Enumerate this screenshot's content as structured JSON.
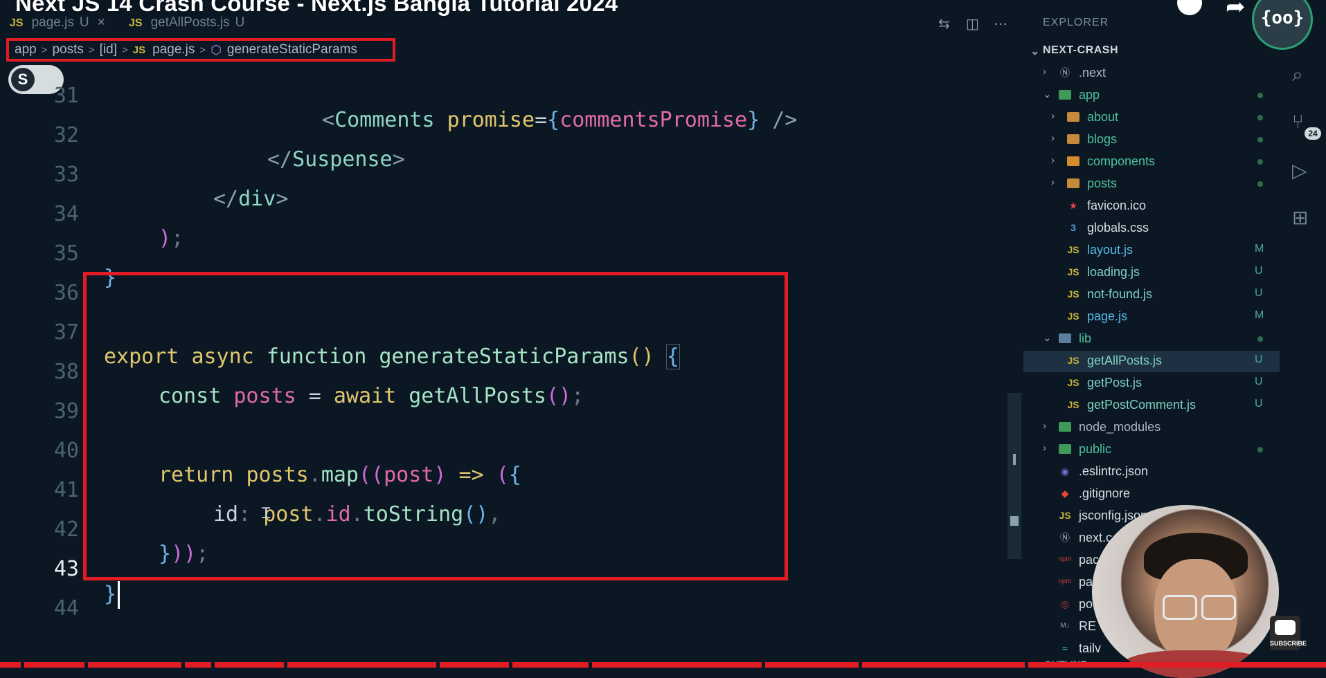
{
  "video_title": "Next JS 14 Crash Course - Next.js Bangla Tutorial 2024",
  "tabs": [
    {
      "icon": "JS",
      "name": "page.js",
      "status": "U",
      "close": "×"
    },
    {
      "icon": "JS",
      "name": "getAllPosts.js",
      "status": "U"
    }
  ],
  "editor_actions": [
    "⇆",
    "◫",
    "⋯"
  ],
  "breadcrumb": {
    "parts": [
      "app",
      "posts",
      "[id]"
    ],
    "file_icon": "JS",
    "file": "page.js",
    "symbol": "generateStaticParams",
    "separator": ">"
  },
  "toggle_label": "S",
  "code": {
    "line_numbers": [
      "31",
      "32",
      "33",
      "34",
      "35",
      "36",
      "37",
      "38",
      "39",
      "40",
      "41",
      "42",
      "43",
      "44"
    ],
    "current_line": "43"
  },
  "explorer": {
    "title": "EXPLORER",
    "root": "NEXT-CRASH",
    "items": [
      {
        "name": ".next",
        "status": ""
      },
      {
        "name": "app",
        "status": ""
      },
      {
        "name": "about",
        "status": ""
      },
      {
        "name": "blogs",
        "status": ""
      },
      {
        "name": "components",
        "status": ""
      },
      {
        "name": "posts",
        "status": ""
      },
      {
        "name": "favicon.ico",
        "status": ""
      },
      {
        "name": "globals.css",
        "status": ""
      },
      {
        "name": "layout.js",
        "status": "M"
      },
      {
        "name": "loading.js",
        "status": "U"
      },
      {
        "name": "not-found.js",
        "status": "U"
      },
      {
        "name": "page.js",
        "status": "M"
      },
      {
        "name": "lib",
        "status": ""
      },
      {
        "name": "getAllPosts.js",
        "status": "U"
      },
      {
        "name": "getPost.js",
        "status": "U"
      },
      {
        "name": "getPostComment.js",
        "status": "U"
      },
      {
        "name": "node_modules",
        "status": ""
      },
      {
        "name": "public",
        "status": ""
      },
      {
        "name": ".eslintrc.json",
        "status": ""
      },
      {
        "name": ".gitignore",
        "status": ""
      },
      {
        "name": "jsconfig.json",
        "status": ""
      },
      {
        "name": "next.c",
        "status": ""
      },
      {
        "name": "pac",
        "status": ""
      },
      {
        "name": "pa",
        "status": ""
      },
      {
        "name": "po",
        "status": ""
      },
      {
        "name": "RE",
        "status": ""
      },
      {
        "name": "tailv",
        "status": ""
      }
    ],
    "outline": "OUTLINE"
  },
  "activity": {
    "source_control_badge": "24"
  },
  "overlay": {
    "channel_logo": "{oo}",
    "subscribe": "SUBSCRIBE"
  },
  "colors": {
    "highlight_border": "#e21c24",
    "background": "#0b1824",
    "selected_row": "#1d3142"
  }
}
